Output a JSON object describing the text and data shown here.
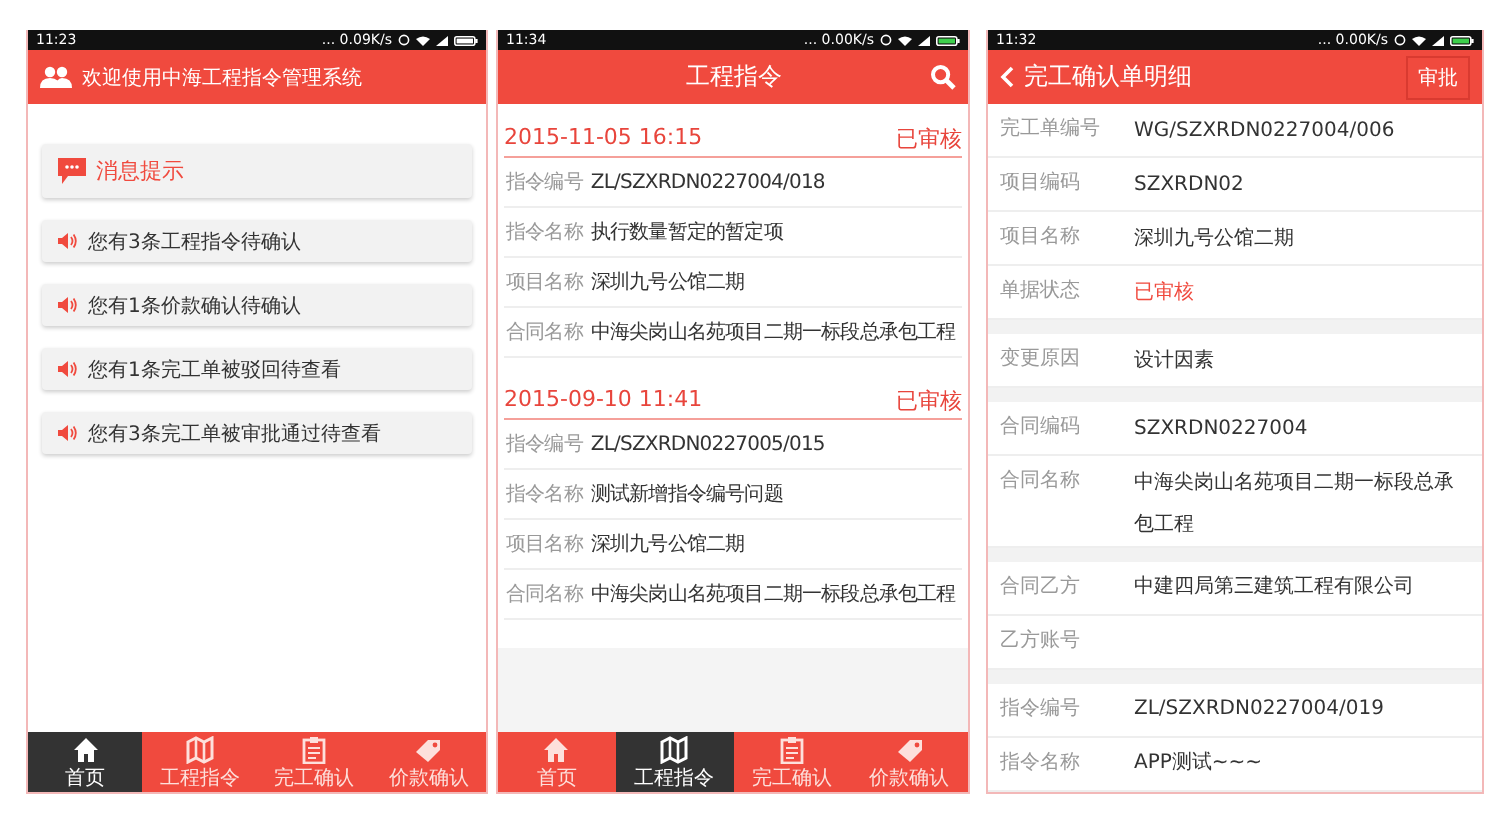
{
  "screens": [
    {
      "kind": "home",
      "status_bar": {
        "time": "11:23",
        "network": "... 0.09K/s",
        "charging": false
      },
      "header": {
        "title": "欢迎使用中海工程指令管理系统"
      },
      "message_header": "消息提示",
      "notices": [
        "您有3条工程指令待确认",
        "您有1条价款确认待确认",
        "您有1条完工单被驳回待查看",
        "您有3条完工单被审批通过待查看"
      ],
      "tab_bar": [
        {
          "label": "首页",
          "selected": true
        },
        {
          "label": "工程指令",
          "selected": false
        },
        {
          "label": "完工确认",
          "selected": false
        },
        {
          "label": "价款确认",
          "selected": false
        }
      ]
    },
    {
      "kind": "list",
      "status_bar": {
        "time": "11:34",
        "network": "... 0.00K/s",
        "charging": true
      },
      "header": {
        "title": "工程指令"
      },
      "records": [
        {
          "time": "2015-11-05 16:15",
          "status": "已审核",
          "fields": [
            {
              "label": "指令编号",
              "value": "ZL/SZXRDN0227004/018"
            },
            {
              "label": "指令名称",
              "value": "执行数量暂定的暂定项"
            },
            {
              "label": "项目名称",
              "value": "深圳九号公馆二期"
            },
            {
              "label": "合同名称",
              "value": "中海尖岗山名苑项目二期一标段总承包工程"
            }
          ]
        },
        {
          "time": "2015-09-10 11:41",
          "status": "已审核",
          "fields": [
            {
              "label": "指令编号",
              "value": "ZL/SZXRDN0227005/015"
            },
            {
              "label": "指令名称",
              "value": "测试新增指令编号问题"
            },
            {
              "label": "项目名称",
              "value": "深圳九号公馆二期"
            },
            {
              "label": "合同名称",
              "value": "中海尖岗山名苑项目二期一标段总承包工程"
            }
          ]
        }
      ],
      "tab_bar": [
        {
          "label": "首页",
          "selected": false
        },
        {
          "label": "工程指令",
          "selected": true
        },
        {
          "label": "完工确认",
          "selected": false
        },
        {
          "label": "价款确认",
          "selected": false
        }
      ]
    },
    {
      "kind": "detail",
      "status_bar": {
        "time": "11:32",
        "network": "... 0.00K/s",
        "charging": true
      },
      "header": {
        "title": "完工确认单明细",
        "action": "审批"
      },
      "groups": [
        [
          {
            "label": "完工单编号",
            "value": "WG/SZXRDN0227004/006",
            "kind": "text"
          },
          {
            "label": "项目编码",
            "value": "SZXRDN02",
            "kind": "text"
          },
          {
            "label": "项目名称",
            "value": "深圳九号公馆二期",
            "kind": "text"
          },
          {
            "label": "单据状态",
            "value": "已审核",
            "kind": "status"
          }
        ],
        [
          {
            "label": "变更原因",
            "value": "设计因素",
            "kind": "text"
          }
        ],
        [
          {
            "label": "合同编码",
            "value": "SZXRDN0227004",
            "kind": "text"
          },
          {
            "label": "合同名称",
            "value": "中海尖岗山名苑项目二期一标段总承包工程",
            "kind": "text"
          }
        ],
        [
          {
            "label": "合同乙方",
            "value": "中建四局第三建筑工程有限公司",
            "kind": "text"
          },
          {
            "label": "乙方账号",
            "kind": "text"
          }
        ],
        [
          {
            "label": "指令编号",
            "value": "ZL/SZXRDN0227004/019",
            "kind": "text"
          },
          {
            "label": "指令名称",
            "value": "APP测试~~~",
            "kind": "text"
          }
        ]
      ]
    }
  ]
}
